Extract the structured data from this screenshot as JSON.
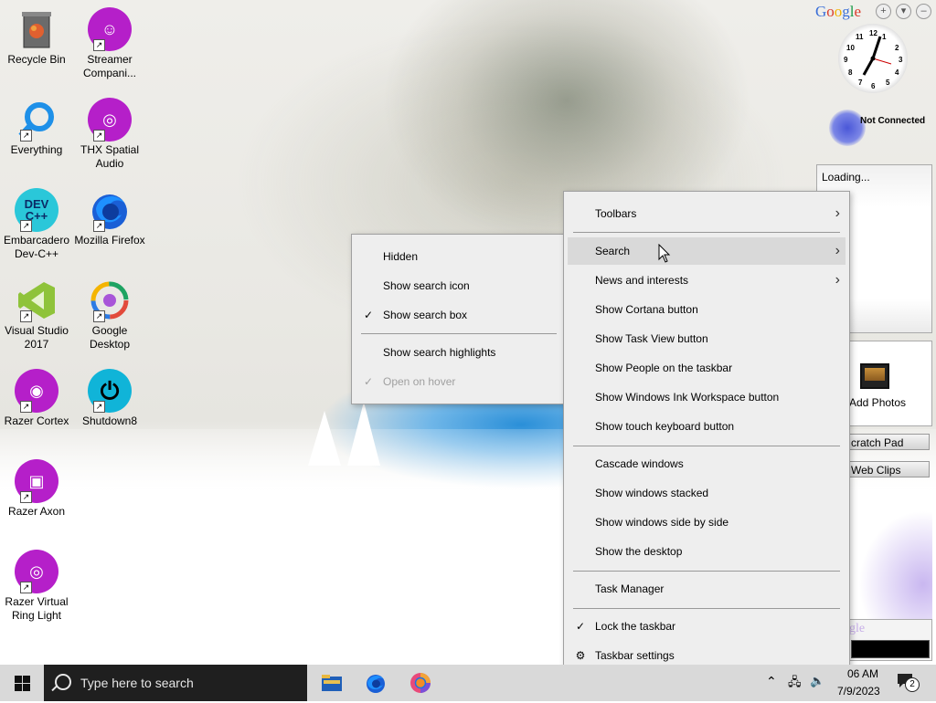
{
  "desktop": {
    "icons": [
      {
        "label": "Recycle Bin",
        "icon": "recycle-bin-icon"
      },
      {
        "label": "Streamer Compani...",
        "icon": "streamer-companion-icon"
      },
      {
        "label": "Everything",
        "icon": "everything-search-icon"
      },
      {
        "label": "THX Spatial Audio",
        "icon": "thx-spatial-audio-icon"
      },
      {
        "label": "Embarcadero Dev-C++",
        "icon": "devcpp-icon",
        "glyph": "DEV C++"
      },
      {
        "label": "Mozilla Firefox",
        "icon": "firefox-icon"
      },
      {
        "label": "Visual Studio 2017",
        "icon": "visual-studio-icon"
      },
      {
        "label": "Google Desktop",
        "icon": "google-desktop-icon"
      },
      {
        "label": "Razer Cortex",
        "icon": "razer-cortex-icon"
      },
      {
        "label": "Shutdown8",
        "icon": "shutdown8-icon"
      },
      {
        "label": "Razer Axon",
        "icon": "razer-axon-icon"
      },
      {
        "label": "Razer Virtual Ring Light",
        "icon": "razer-ring-light-icon"
      }
    ]
  },
  "gadgets": {
    "google_label": "Google",
    "network_status": "Not Connected",
    "loading_text": "Loading...",
    "add_photos": "Add Photos",
    "scratch_pad": "cratch Pad",
    "web_clips": "Web Clips",
    "google_fragment": "gle"
  },
  "context_menu": {
    "items": [
      {
        "label": "Toolbars",
        "submenu": true
      },
      {
        "label": "Search",
        "submenu": true,
        "highlighted": true
      },
      {
        "label": "News and interests",
        "submenu": true
      },
      {
        "label": "Show Cortana button"
      },
      {
        "label": "Show Task View button"
      },
      {
        "label": "Show People on the taskbar"
      },
      {
        "label": "Show Windows Ink Workspace button"
      },
      {
        "label": "Show touch keyboard button"
      },
      {
        "label": "Cascade windows"
      },
      {
        "label": "Show windows stacked"
      },
      {
        "label": "Show windows side by side"
      },
      {
        "label": "Show the desktop"
      },
      {
        "label": "Task Manager"
      },
      {
        "label": "Lock the taskbar",
        "checked": true
      },
      {
        "label": "Taskbar settings",
        "icon": "gear-icon"
      }
    ]
  },
  "search_submenu": {
    "items": [
      {
        "label": "Hidden"
      },
      {
        "label": "Show search icon"
      },
      {
        "label": "Show search box",
        "checked": true
      },
      {
        "label": "Show search highlights"
      },
      {
        "label": "Open on hover",
        "checked": true,
        "disabled": true
      }
    ]
  },
  "taskbar": {
    "search_placeholder": "Type here to search",
    "pinned": [
      "file-explorer-icon",
      "firefox-icon",
      "chrome-like-icon"
    ],
    "time": "06 AM",
    "date": "7/9/2023",
    "notification_count": "2"
  },
  "colors": {
    "accent_purple": "#b51fc9",
    "menu_bg": "#eeeeee",
    "menu_highlight": "#d9d9d9",
    "taskbar_bg": "#d9d9d9",
    "search_bg": "#1f1f1f"
  }
}
